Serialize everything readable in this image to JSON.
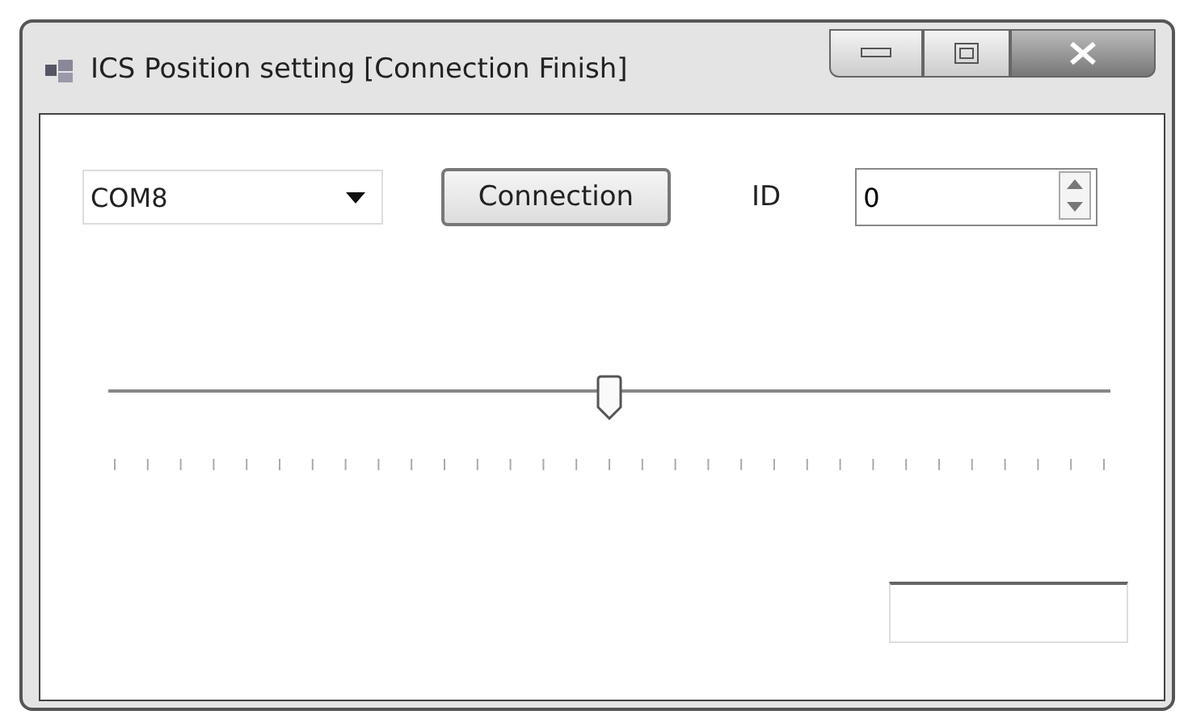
{
  "window": {
    "title": "ICS Position setting [Connection Finish]"
  },
  "port": {
    "value": "COM8"
  },
  "connect_button": {
    "label": "Connection"
  },
  "id": {
    "label": "ID",
    "value": "0"
  },
  "slider": {
    "level": 0.5
  }
}
